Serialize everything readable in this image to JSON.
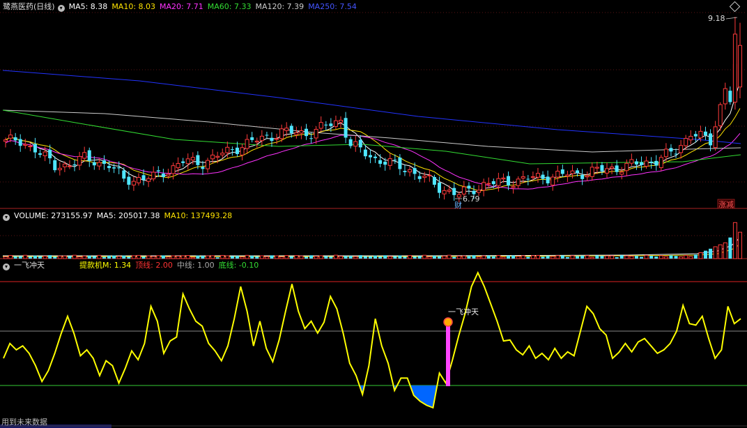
{
  "header_main": {
    "title": "鹭燕医药(日线)",
    "ma5": "MA5: 8.38",
    "ma10": "MA10: 8.03",
    "ma20": "MA20: 7.71",
    "ma60": "MA60: 7.33",
    "ma120": "MA120: 7.39",
    "ma250": "MA250: 7.54"
  },
  "header_volume": {
    "volume": "VOLUME: 273155.97",
    "ma5": "MA5: 205017.38",
    "ma10": "MA10: 137493.28"
  },
  "header_indicator": {
    "name": "一飞冲天",
    "m": "提款机M: 1.34",
    "top": "顶线: 2.00",
    "mid": "中线: 1.00",
    "bottom": "底线: -0.10"
  },
  "annotations": {
    "high": "9.18",
    "low": "6.79",
    "cai": "财",
    "zhang": "涨",
    "jian": "减",
    "signal": "一飞冲天"
  },
  "footer": "用到未来数据",
  "colors": {
    "up": "#ff3b3b",
    "down": "#4fe6ff",
    "ma5": "#ffffff",
    "ma10": "#ffe400",
    "ma20": "#ff33ff",
    "ma60": "#33dd33",
    "ma120": "#cccccc",
    "ma250": "#2233ff",
    "indicator": "#ffff00",
    "fill": "#0066ff",
    "signal": "#ff44ff"
  },
  "chart_data": [
    {
      "type": "candlestick",
      "name": "price",
      "count": 150,
      "price_range_visible": [
        6.79,
        9.18
      ],
      "ma_values": {
        "MA5": 8.38,
        "MA10": 8.03,
        "MA20": 7.71,
        "MA60": 7.33,
        "MA120": 7.39,
        "MA250": 7.54
      }
    },
    {
      "type": "bar",
      "name": "volume",
      "latest": 273155.97,
      "ma5": 205017.38,
      "ma10": 137493.28
    },
    {
      "type": "line",
      "name": "indicator",
      "latest": 1.34,
      "levels": {
        "top": 2.0,
        "mid": 1.0,
        "bottom": -0.1
      },
      "values": [
        0.45,
        0.75,
        0.62,
        0.7,
        0.55,
        0.3,
        -0.02,
        0.2,
        0.55,
        0.95,
        1.3,
        0.95,
        0.5,
        0.62,
        0.45,
        0.1,
        0.4,
        0.3,
        -0.05,
        0.25,
        0.6,
        0.42,
        0.75,
        1.5,
        1.2,
        0.55,
        0.8,
        0.88,
        1.75,
        1.45,
        1.2,
        1.1,
        0.75,
        0.6,
        0.4,
        0.7,
        1.25,
        1.9,
        1.4,
        0.7,
        1.2,
        0.65,
        0.38,
        0.82,
        1.4,
        1.95,
        1.4,
        1.05,
        1.2,
        0.96,
        1.18,
        1.7,
        1.45,
        0.95,
        0.35,
        0.1,
        -0.28,
        0.3,
        1.25,
        0.7,
        0.35,
        -0.2,
        0.05,
        0.05,
        -0.3,
        -0.42,
        -0.5,
        -0.55,
        0.15,
        -0.05,
        0.4,
        0.9,
        1.35,
        1.9,
        2.18,
        1.9,
        1.55,
        1.2,
        0.8,
        0.82,
        0.62,
        0.52,
        0.7,
        0.45,
        0.55,
        0.42,
        0.65,
        0.45,
        0.58,
        0.5,
        1.0,
        1.5,
        1.35,
        1.05,
        0.92,
        0.45,
        0.57,
        0.75,
        0.58,
        0.78,
        0.85,
        0.7,
        0.55,
        0.62,
        0.75,
        1.0,
        1.52,
        1.15,
        1.12,
        1.3,
        0.85,
        0.45,
        0.62,
        1.5,
        1.15,
        1.25
      ],
      "signal_label": "一飞冲天"
    }
  ]
}
